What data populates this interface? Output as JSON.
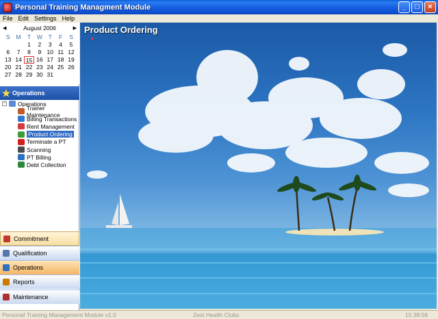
{
  "window": {
    "title": "Personal Training Managment Module"
  },
  "menu": {
    "items": [
      "File",
      "Edit",
      "Settings",
      "Help"
    ]
  },
  "calendar": {
    "month": "August 2006",
    "days_of_week": [
      "S",
      "M",
      "T",
      "W",
      "T",
      "F",
      "S"
    ],
    "weeks": [
      [
        "",
        "",
        "1",
        "2",
        "3",
        "4",
        "5"
      ],
      [
        "6",
        "7",
        "8",
        "9",
        "10",
        "11",
        "12"
      ],
      [
        "13",
        "14",
        "15",
        "16",
        "17",
        "18",
        "19"
      ],
      [
        "20",
        "21",
        "22",
        "23",
        "24",
        "25",
        "26"
      ],
      [
        "27",
        "28",
        "29",
        "30",
        "31",
        "",
        ""
      ]
    ],
    "highlighted_day": "15"
  },
  "operations_header": "Operations",
  "tree": {
    "root": "Operations",
    "items": [
      {
        "label": "Trainer Maintenance",
        "icon": "trainer-icon",
        "color": "#c05a2a"
      },
      {
        "label": "Billing Transactions",
        "icon": "billing-icon",
        "color": "#2f7ad0"
      },
      {
        "label": "Rent Management",
        "icon": "rent-icon",
        "color": "#d23c3c"
      },
      {
        "label": "Product Ordering",
        "icon": "product-icon",
        "color": "#3f9a3a"
      },
      {
        "label": "Terminate a PT",
        "icon": "terminate-icon",
        "color": "#d22020"
      },
      {
        "label": "Scanning",
        "icon": "scanning-icon",
        "color": "#4a4a4a"
      },
      {
        "label": "PT Billing",
        "icon": "pt-billing-icon",
        "color": "#2f6fbf"
      },
      {
        "label": "Debt Collection",
        "icon": "debt-icon",
        "color": "#2a8a3a"
      }
    ],
    "selected": "Product Ordering"
  },
  "nav": [
    {
      "label": "Commitment",
      "icon": "commitment-icon",
      "color": "#c0392b"
    },
    {
      "label": "Qualification",
      "icon": "qualification-icon",
      "color": "#5577aa"
    },
    {
      "label": "Operations",
      "icon": "operations-icon",
      "color": "#2f6fbf"
    },
    {
      "label": "Reports",
      "icon": "reports-icon",
      "color": "#cc7a00"
    },
    {
      "label": "Maintenance",
      "icon": "maintenance-icon",
      "color": "#b03030"
    }
  ],
  "main": {
    "title": "Product Ordering"
  },
  "status": {
    "version": "Personal Training Management Module  v1.0",
    "company": "Zest Health Clubs",
    "time": "15:38:58"
  }
}
